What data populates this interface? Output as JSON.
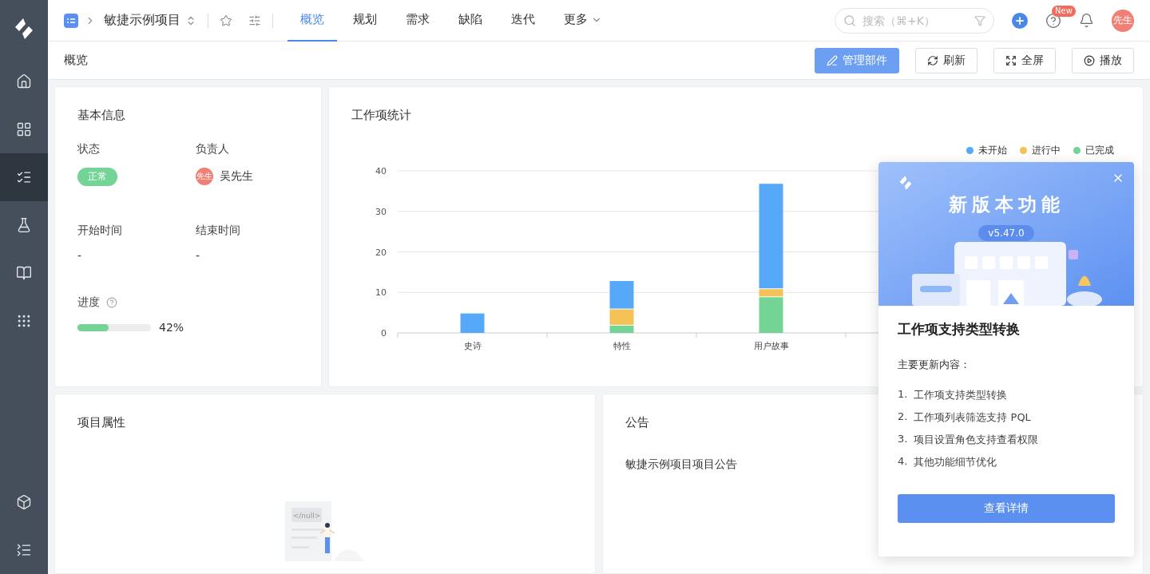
{
  "sidebar": {
    "items": [
      {
        "selected": false
      },
      {
        "selected": false
      },
      {
        "selected": true
      },
      {
        "selected": false
      },
      {
        "selected": false
      },
      {
        "selected": false
      }
    ]
  },
  "header": {
    "project_name": "敏捷示例项目",
    "tabs": [
      {
        "label": "概览",
        "selected": true
      },
      {
        "label": "规划",
        "selected": false
      },
      {
        "label": "需求",
        "selected": false
      },
      {
        "label": "缺陷",
        "selected": false
      },
      {
        "label": "迭代",
        "selected": false
      },
      {
        "label": "更多",
        "selected": false
      }
    ],
    "search": {
      "placeholder": "搜索（⌘+K）"
    },
    "help_badge": "New",
    "avatar": "先生"
  },
  "subheader": {
    "title": "概览",
    "buttons": [
      {
        "label": "管理部件",
        "primary": true
      },
      {
        "label": "刷新",
        "primary": false
      },
      {
        "label": "全屏",
        "primary": false
      },
      {
        "label": "播放",
        "primary": false
      }
    ]
  },
  "basic_info": {
    "title": "基本信息",
    "status_label": "状态",
    "status": "正常",
    "owner_label": "负责人",
    "owner_avatar": "先生",
    "owner": "吴先生",
    "start_label": "开始时间",
    "start": "-",
    "end_label": "结束时间",
    "end": "-",
    "progress_label": "进度",
    "progress": {
      "level": 0.42,
      "reading": "42%"
    }
  },
  "work_stats": {
    "title": "工作项统计",
    "chart_data": {
      "type": "bar",
      "stacked": true,
      "grid": true,
      "categories": [
        "史诗",
        "特性",
        "用户故事"
      ],
      "series": [
        {
          "name": "未开始",
          "color": "#56a9f8",
          "values": [
            5,
            7,
            26
          ]
        },
        {
          "name": "进行中",
          "color": "#f4c257",
          "values": [
            0,
            4,
            2
          ]
        },
        {
          "name": "已完成",
          "color": "#73d496",
          "values": [
            0,
            2,
            9
          ]
        }
      ],
      "ylim": [
        0,
        40
      ],
      "yticks": [
        0,
        10,
        20,
        30,
        40
      ]
    }
  },
  "project_props": {
    "title": "项目属性",
    "empty_code": "</null>"
  },
  "announcement": {
    "title": "公告",
    "text": "敏捷示例项目项目公告"
  },
  "release_popup": {
    "banner_title": "新版本功能",
    "version": "v5.47.0",
    "heading": "工作项支持类型转换",
    "intro": "主要更新内容：",
    "items": [
      {
        "number": "1.",
        "text": "工作项支持类型转换"
      },
      {
        "number": "2.",
        "text": "工作项列表筛选支持 PQL"
      },
      {
        "number": "3.",
        "text": "项目设置角色支持查看权限"
      },
      {
        "number": "4.",
        "text": "其他功能细节优化"
      }
    ],
    "button": "查看详情"
  }
}
